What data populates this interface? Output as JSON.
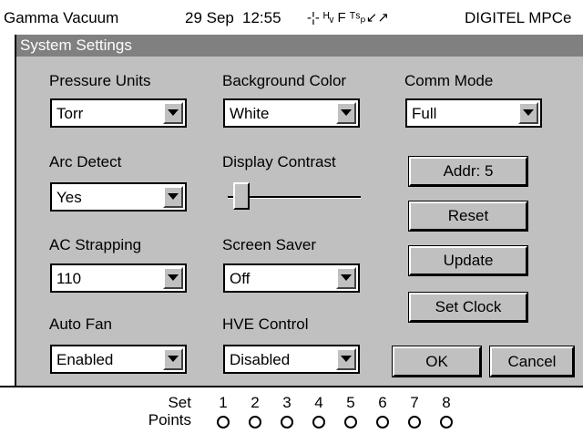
{
  "statusbar": {
    "system_name": "Gamma Vacuum",
    "date": "29 Sep",
    "time": "12:55",
    "indicators": "-¦- ᴴᵥ F ᵀˢₚ↙↗",
    "product": "DIGITEL MPCe"
  },
  "dialog": {
    "title": "System Settings"
  },
  "settings": {
    "pressure_units": {
      "label": "Pressure Units",
      "value": "Torr"
    },
    "background_color": {
      "label": "Background Color",
      "value": "White"
    },
    "comm_mode": {
      "label": "Comm Mode",
      "value": "Full"
    },
    "arc_detect": {
      "label": "Arc Detect",
      "value": "Yes"
    },
    "display_contrast": {
      "label": "Display Contrast",
      "level": 0.05
    },
    "ac_strapping": {
      "label": "AC Strapping",
      "value": "110"
    },
    "screen_saver": {
      "label": "Screen Saver",
      "value": "Off"
    },
    "auto_fan": {
      "label": "Auto Fan",
      "value": "Enabled"
    },
    "hve_control": {
      "label": "HVE Control",
      "value": "Disabled"
    }
  },
  "buttons": {
    "addr": "Addr: 5",
    "reset": "Reset",
    "update": "Update",
    "set_clock": "Set Clock",
    "ok": "OK",
    "cancel": "Cancel"
  },
  "setpoints": {
    "label_line1": "Set",
    "label_line2": "Points",
    "numbers": [
      "1",
      "2",
      "3",
      "4",
      "5",
      "6",
      "7",
      "8"
    ]
  },
  "colors": {
    "dialog_bg": "#c0c0c0",
    "titlebar_bg": "#808080",
    "field_bg": "#ffffff"
  }
}
